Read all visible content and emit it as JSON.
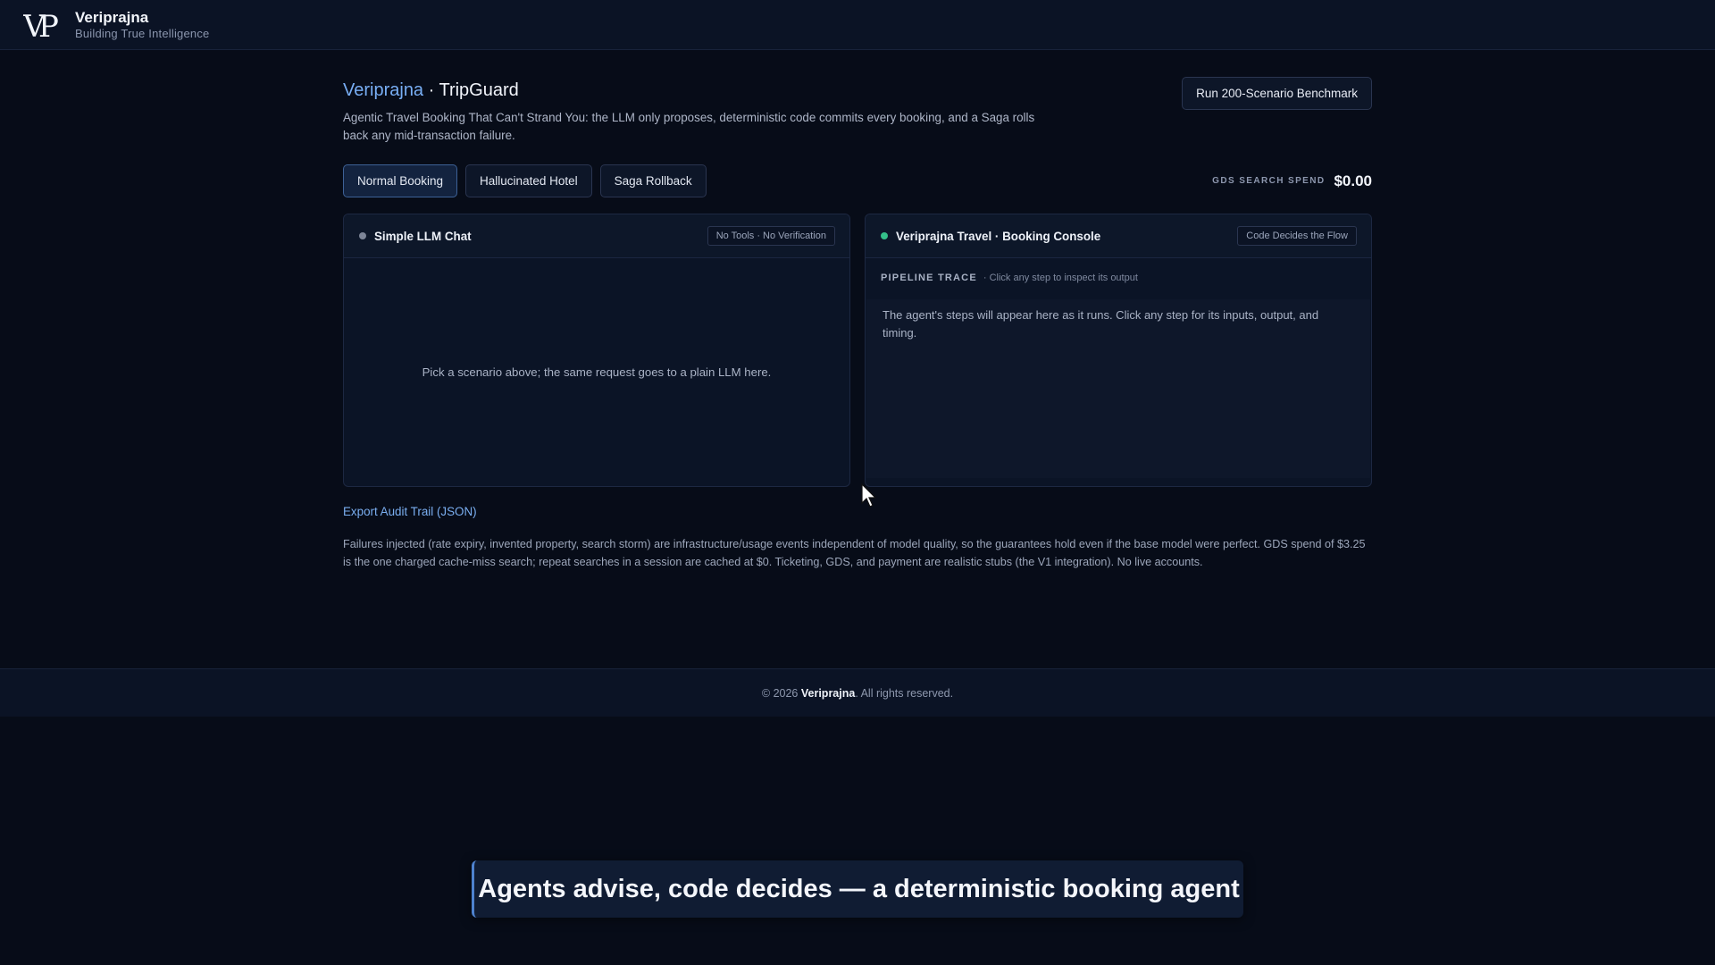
{
  "header": {
    "brand_name": "Veriprajna",
    "brand_tagline": "Building True Intelligence",
    "logo_icon": "vp-monogram-logo"
  },
  "page": {
    "title_accent": "Veriprajna",
    "title_rest": " · TripGuard",
    "description": "Agentic Travel Booking That Can't Strand You: the LLM only proposes, deterministic code commits every booking, and a Saga rolls back any mid-transaction failure.",
    "benchmark_button": "Run 200-Scenario Benchmark"
  },
  "scenarios": {
    "tabs": [
      {
        "label": "Normal Booking",
        "active": true
      },
      {
        "label": "Hallucinated Hotel",
        "active": false
      },
      {
        "label": "Saga Rollback",
        "active": false
      }
    ]
  },
  "spend": {
    "label": "GDS SEARCH SPEND",
    "value": "$0.00"
  },
  "left_panel": {
    "title": "Simple LLM Chat",
    "badge": "No Tools · No Verification",
    "status_color": "#7d8597",
    "placeholder": "Pick a scenario above; the same request goes to a plain LLM here."
  },
  "right_panel": {
    "title": "Veriprajna Travel · Booking Console",
    "badge": "Code Decides the Flow",
    "status_color": "#34c08a",
    "trace_label": "PIPELINE TRACE",
    "trace_hint": "· Click any step to inspect its output",
    "trace_placeholder": "The agent's steps will appear here as it runs. Click any step for its inputs, output, and timing."
  },
  "export_link": "Export Audit Trail (JSON)",
  "footnote": "Failures injected (rate expiry, invented property, search storm) are infrastructure/usage events independent of model quality, so the guarantees hold even if the base model were perfect. GDS spend of $3.25 is the one charged cache-miss search; repeat searches in a session are cached at $0. Ticketing, GDS, and payment are realistic stubs (the V1 integration). No live accounts.",
  "footer": {
    "prefix": "© 2026 ",
    "brand": "Veriprajna",
    "suffix": ". All rights reserved."
  },
  "caption": "Agents advise, code decides — a deterministic booking agent",
  "colors": {
    "accent": "#78aef4",
    "background": "#070c18"
  }
}
